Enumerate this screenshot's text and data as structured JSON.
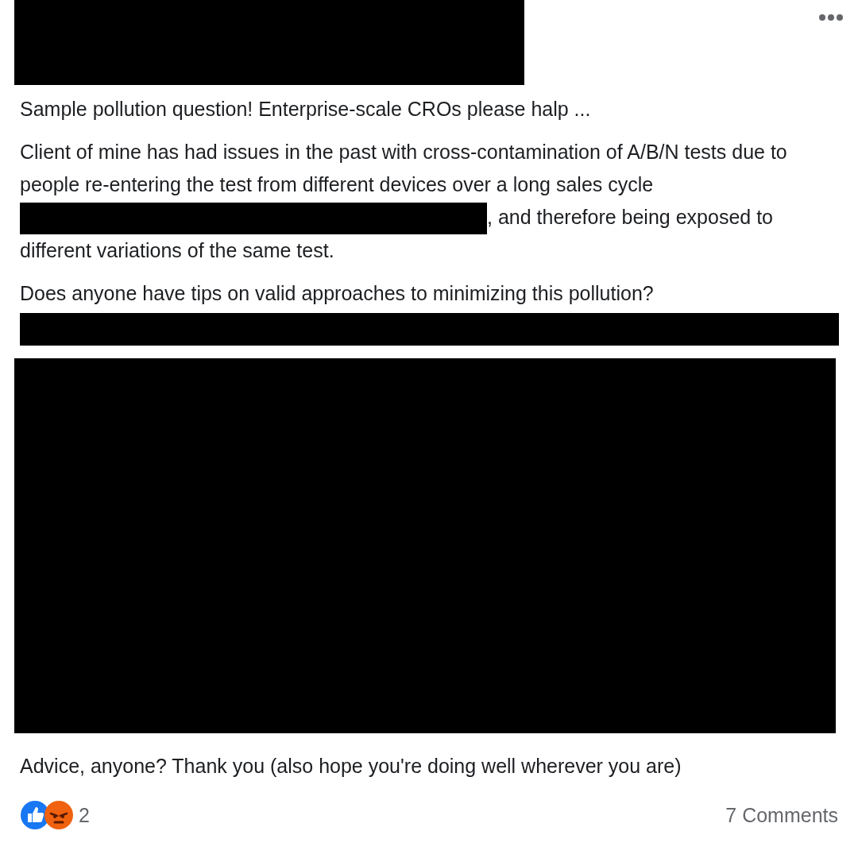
{
  "post": {
    "title": "Sample pollution question! Enterprise-scale CROs please halp ...",
    "paragraph_before_redaction": "Client of mine has had issues in the past with cross-contamination of A/B/N tests due to people re-entering the test from different devices over a long sales cycle",
    "paragraph_after_redaction": ", and therefore being exposed to different variations of the same test.",
    "question": "Does anyone have tips on valid approaches to minimizing this pollution?",
    "closing": "Advice, anyone? Thank you (also hope you're doing well wherever you are)"
  },
  "reactions": {
    "count": "2"
  },
  "comments": "7 Comments"
}
